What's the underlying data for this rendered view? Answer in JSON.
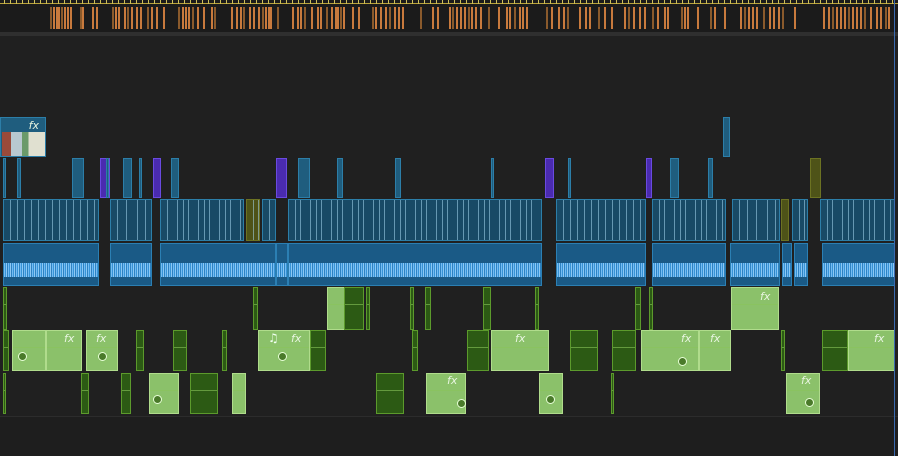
{
  "timeline": {
    "name": "sequence-timeline"
  },
  "clips": {
    "fx_label": "fx",
    "music_note": "♫"
  },
  "colors": {
    "video": "#1f5d7e",
    "adjustment": "#4a2bb0",
    "olive": "#4e5318",
    "audio_blue": "#1a5a86",
    "audio_green": "#2c5a14",
    "audio_green_light": "#8bc16a",
    "marker": "#c87a3d",
    "ruler_line": "#b8a23a"
  }
}
